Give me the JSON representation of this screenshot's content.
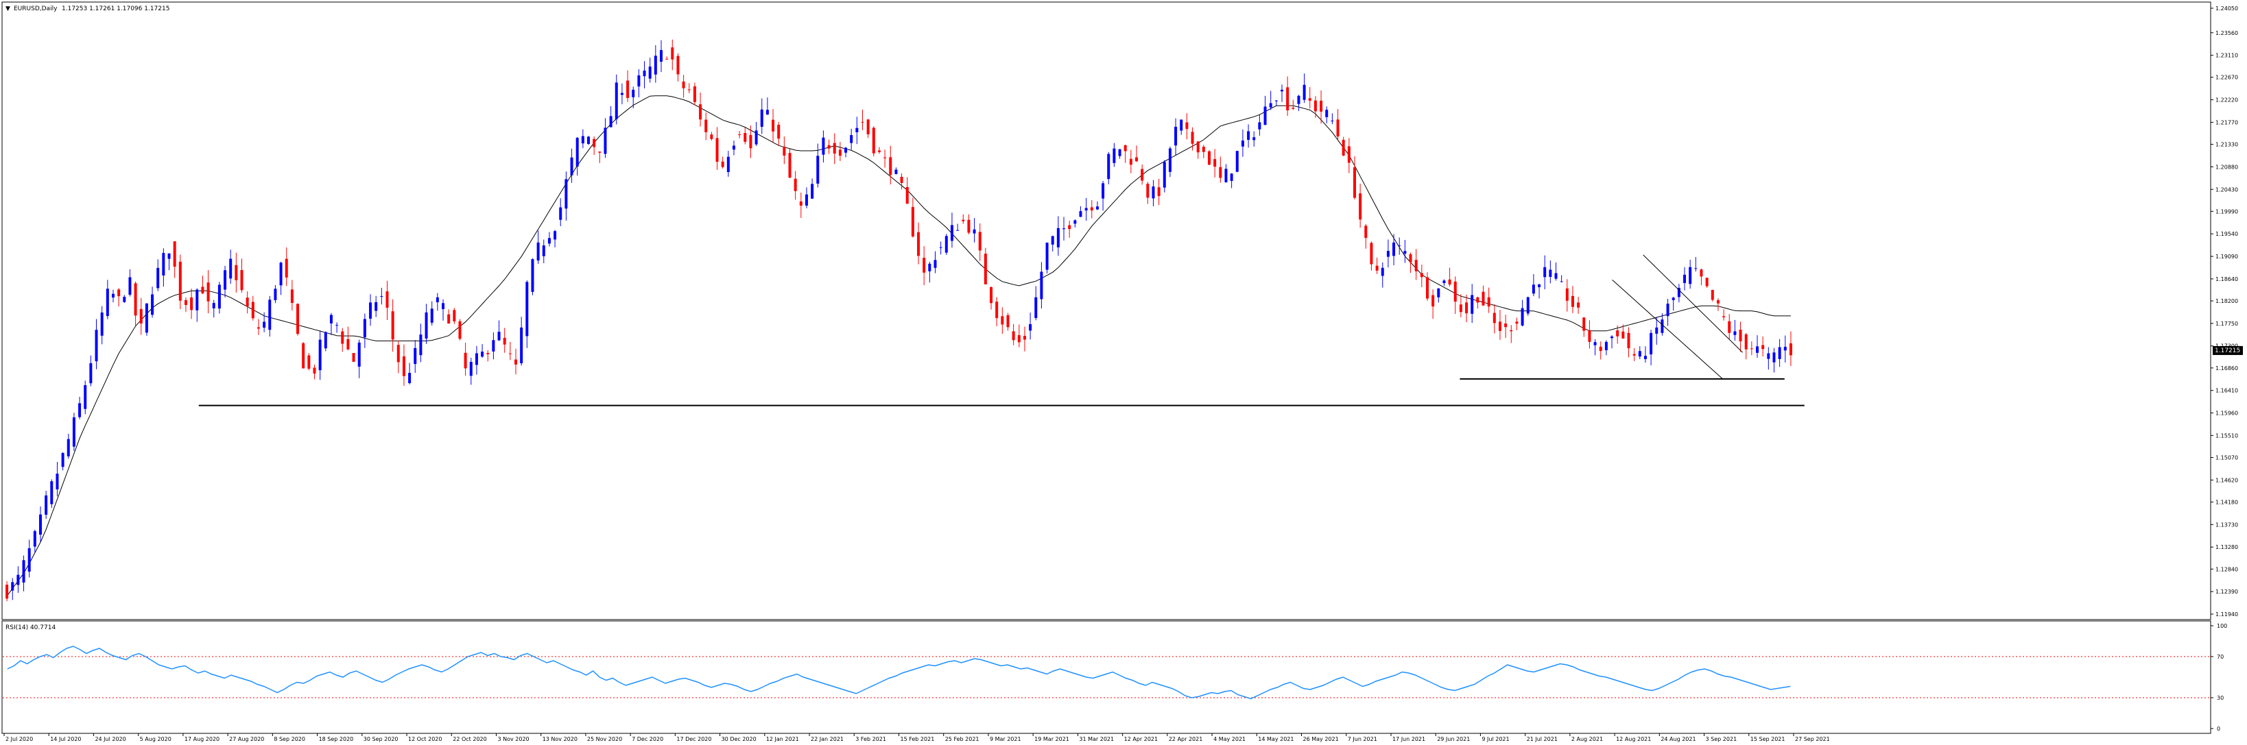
{
  "header": {
    "triangle": "▼",
    "title": "EURUSD,Daily",
    "ohlc": "1.17253 1.17261 1.17096 1.17215"
  },
  "rsi_header": "RSI(14) 40.7714",
  "colors": {
    "bull": "#0000FF",
    "bear": "#FF0000",
    "ma": "#000000",
    "rsi": "#1E90FF",
    "rsi_level": "#FF0000",
    "price_tag_bg": "#000000"
  },
  "current_price_label": "1.17215",
  "chart_data": [
    {
      "type": "candlestick",
      "ylim": [
        1.1194,
        1.2405
      ],
      "y_ticks": [
        "1.24050",
        "1.23560",
        "1.23110",
        "1.22670",
        "1.22220",
        "1.21770",
        "1.21330",
        "1.20880",
        "1.20430",
        "1.19990",
        "1.19540",
        "1.19090",
        "1.18640",
        "1.18200",
        "1.17750",
        "1.17300",
        "1.16860",
        "1.16410",
        "1.15960",
        "1.15510",
        "1.15070",
        "1.14620",
        "1.14180",
        "1.13730",
        "1.13280",
        "1.12840",
        "1.12390",
        "1.11940"
      ],
      "x_labels": [
        "2 Jul 2020",
        "14 Jul 2020",
        "24 Jul 2020",
        "5 Aug 2020",
        "17 Aug 2020",
        "27 Aug 2020",
        "8 Sep 2020",
        "18 Sep 2020",
        "30 Sep 2020",
        "12 Oct 2020",
        "22 Oct 2020",
        "3 Nov 2020",
        "13 Nov 2020",
        "25 Nov 2020",
        "7 Dec 2020",
        "17 Dec 2020",
        "30 Dec 2020",
        "12 Jan 2021",
        "22 Jan 2021",
        "3 Feb 2021",
        "15 Feb 2021",
        "25 Feb 2021",
        "9 Mar 2021",
        "19 Mar 2021",
        "31 Mar 2021",
        "12 Apr 2021",
        "22 Apr 2021",
        "4 May 2021",
        "14 May 2021",
        "26 May 2021",
        "7 Jun 2021",
        "17 Jun 2021",
        "29 Jun 2021",
        "9 Jul 2021",
        "21 Jul 2021",
        "2 Aug 2021",
        "12 Aug 2021",
        "24 Aug 2021",
        "3 Sep 2021",
        "15 Sep 2021",
        "27 Sep 2021"
      ],
      "close_path": [
        1.124,
        1.126,
        1.131,
        1.136,
        1.143,
        1.148,
        1.154,
        1.16,
        1.168,
        1.177,
        1.184,
        1.182,
        1.186,
        1.175,
        1.183,
        1.189,
        1.193,
        1.183,
        1.181,
        1.186,
        1.179,
        1.185,
        1.19,
        1.184,
        1.178,
        1.176,
        1.183,
        1.19,
        1.18,
        1.17,
        1.167,
        1.175,
        1.179,
        1.174,
        1.17,
        1.177,
        1.182,
        1.183,
        1.173,
        1.166,
        1.171,
        1.178,
        1.182,
        1.18,
        1.177,
        1.168,
        1.17,
        1.172,
        1.176,
        1.172,
        1.168,
        1.185,
        1.192,
        1.195,
        1.198,
        1.207,
        1.214,
        1.215,
        1.212,
        1.217,
        1.226,
        1.223,
        1.226,
        1.228,
        1.231,
        1.232,
        1.225,
        1.224,
        1.218,
        1.215,
        1.208,
        1.213,
        1.217,
        1.212,
        1.22,
        1.218,
        1.212,
        1.205,
        1.2,
        1.205,
        1.214,
        1.213,
        1.212,
        1.216,
        1.218,
        1.213,
        1.21,
        1.208,
        1.203,
        1.195,
        1.187,
        1.191,
        1.194,
        1.197,
        1.198,
        1.195,
        1.186,
        1.18,
        1.177,
        1.173,
        1.175,
        1.183,
        1.193,
        1.195,
        1.197,
        1.2,
        1.201,
        1.202,
        1.21,
        1.213,
        1.211,
        1.209,
        1.203,
        1.204,
        1.212,
        1.218,
        1.214,
        1.213,
        1.21,
        1.206,
        1.208,
        1.213,
        1.215,
        1.218,
        1.223,
        1.224,
        1.22,
        1.225,
        1.221,
        1.22,
        1.218,
        1.213,
        1.206,
        1.196,
        1.187,
        1.19,
        1.193,
        1.192,
        1.19,
        1.185,
        1.182,
        1.187,
        1.183,
        1.179,
        1.184,
        1.181,
        1.177,
        1.176,
        1.178,
        1.182,
        1.186,
        1.188,
        1.186,
        1.183,
        1.18,
        1.175,
        1.172,
        1.174,
        1.176,
        1.173,
        1.17,
        1.173,
        1.177,
        1.181,
        1.184,
        1.188,
        1.187,
        1.183,
        1.18,
        1.176,
        1.174,
        1.173,
        1.172,
        1.17,
        1.173,
        1.172
      ],
      "ma_path": [
        1.123,
        1.128,
        1.135,
        1.145,
        1.155,
        1.163,
        1.171,
        1.177,
        1.181,
        1.183,
        1.184,
        1.184,
        1.183,
        1.181,
        1.179,
        1.178,
        1.177,
        1.176,
        1.175,
        1.175,
        1.174,
        1.174,
        1.174,
        1.174,
        1.175,
        1.178,
        1.182,
        1.186,
        1.191,
        1.197,
        1.203,
        1.209,
        1.214,
        1.218,
        1.221,
        1.223,
        1.223,
        1.222,
        1.22,
        1.218,
        1.217,
        1.215,
        1.213,
        1.212,
        1.212,
        1.213,
        1.212,
        1.21,
        1.207,
        1.204,
        1.2,
        1.197,
        1.193,
        1.189,
        1.186,
        1.185,
        1.186,
        1.188,
        1.192,
        1.197,
        1.201,
        1.205,
        1.208,
        1.21,
        1.212,
        1.214,
        1.217,
        1.218,
        1.219,
        1.221,
        1.221,
        1.22,
        1.216,
        1.211,
        1.204,
        1.197,
        1.191,
        1.187,
        1.185,
        1.183,
        1.182,
        1.181,
        1.18,
        1.18,
        1.179,
        1.178,
        1.176,
        1.176,
        1.177,
        1.178,
        1.179,
        1.18,
        1.181,
        1.181,
        1.18,
        1.18,
        1.179,
        1.179
      ],
      "support_lines": [
        {
          "from": 0.09,
          "to": 0.817,
          "price": 1.1611
        },
        {
          "from": 0.661,
          "to": 0.808,
          "price": 1.1664
        }
      ],
      "channel": {
        "upper": {
          "x0": 0.744,
          "y0": 1.1912,
          "x1": 0.789,
          "y1": 1.1717
        },
        "lower": {
          "x0": 0.73,
          "y0": 1.1862,
          "x1": 0.78,
          "y1": 1.1664
        }
      }
    },
    {
      "type": "line",
      "name": "RSI(14)",
      "ylim": [
        0,
        100
      ],
      "y_ticks": [
        "100",
        "70",
        "30",
        "0"
      ],
      "levels": [
        70,
        30
      ],
      "values": [
        58,
        61,
        66,
        63,
        67,
        70,
        72,
        69,
        74,
        78,
        80,
        77,
        73,
        76,
        78,
        74,
        71,
        69,
        67,
        71,
        73,
        70,
        66,
        62,
        60,
        58,
        60,
        61,
        57,
        54,
        56,
        53,
        51,
        49,
        52,
        50,
        48,
        46,
        43,
        41,
        38,
        35,
        38,
        42,
        45,
        44,
        47,
        51,
        53,
        55,
        52,
        50,
        54,
        56,
        53,
        50,
        47,
        45,
        48,
        52,
        55,
        58,
        60,
        62,
        60,
        57,
        55,
        58,
        62,
        66,
        70,
        72,
        74,
        71,
        73,
        70,
        69,
        67,
        71,
        73,
        70,
        67,
        64,
        66,
        63,
        60,
        57,
        55,
        52,
        56,
        50,
        47,
        49,
        45,
        42,
        44,
        46,
        48,
        50,
        47,
        44,
        46,
        48,
        49,
        47,
        45,
        42,
        40,
        42,
        44,
        43,
        41,
        38,
        36,
        38,
        41,
        44,
        46,
        49,
        51,
        53,
        50,
        48,
        46,
        44,
        42,
        40,
        38,
        36,
        34,
        37,
        40,
        43,
        46,
        49,
        51,
        54,
        56,
        58,
        60,
        62,
        61,
        63,
        65,
        66,
        64,
        66,
        68,
        67,
        65,
        63,
        61,
        62,
        60,
        58,
        59,
        57,
        55,
        53,
        56,
        58,
        56,
        54,
        52,
        50,
        49,
        51,
        53,
        55,
        52,
        49,
        47,
        44,
        42,
        45,
        43,
        41,
        39,
        36,
        32,
        30,
        31,
        33,
        35,
        34,
        36,
        37,
        33,
        31,
        29,
        32,
        35,
        38,
        40,
        43,
        45,
        42,
        39,
        38,
        40,
        42,
        45,
        48,
        50,
        47,
        44,
        41,
        43,
        46,
        48,
        50,
        52,
        55,
        54,
        52,
        49,
        46,
        43,
        40,
        38,
        37,
        39,
        41,
        43,
        47,
        51,
        54,
        58,
        62,
        60,
        58,
        56,
        55,
        57,
        59,
        61,
        63,
        62,
        60,
        57,
        55,
        53,
        51,
        50,
        48,
        46,
        44,
        42,
        40,
        38,
        37,
        39,
        42,
        45,
        48,
        52,
        55,
        57,
        58,
        56,
        53,
        51,
        50,
        48,
        46,
        44,
        42,
        40,
        38,
        39,
        40,
        41
      ]
    }
  ]
}
